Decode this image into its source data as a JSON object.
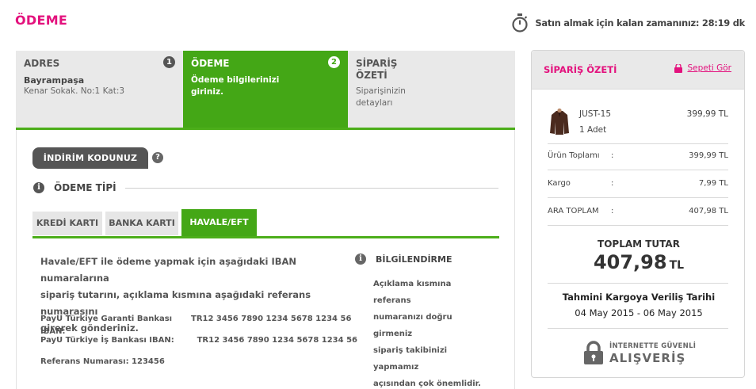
{
  "page": {
    "title": "ÖDEME",
    "timer_text": "Satın almak için kalan zamanınız: 28:19 dk"
  },
  "steps": [
    {
      "title": "ADRES",
      "number": "1",
      "sub": "Bayrampaşa",
      "desc": "Kenar Sokak. No:1 Kat:3",
      "active": false
    },
    {
      "title": "ÖDEME",
      "number": "2",
      "desc_line1": "Ödeme bilgilerinizi",
      "desc_line2": "giriniz.",
      "active": true
    },
    {
      "title_line1": "SİPARİŞ",
      "title_line2": "ÖZETİ",
      "desc_line1": "Siparişinizin",
      "desc_line2": "detayları",
      "active": false
    }
  ],
  "discount": {
    "button_label": "İNDİRİM KODUNUZ",
    "help": "?"
  },
  "payment": {
    "info_glyph": "i",
    "section_title": "ÖDEME TİPİ",
    "tabs": [
      "KREDİ KARTI",
      "BANKA KARTI",
      "HAVALE/EFT"
    ],
    "active_tab": "HAVALE/EFT",
    "instructions_line1": "Havale/EFT ile ödeme yapmak için aşağıdaki IBAN numaralarına",
    "instructions_line2": "sipariş tutarını, açıklama kısmına aşağıdaki referans numarasını",
    "instructions_line3": "girerek gönderiniz.",
    "ibans": [
      {
        "label": "PayU Türkiye Garanti Bankası IBAN:",
        "value": "TR12 3456 7890 1234 5678 1234 56"
      },
      {
        "label": "PayU Türkiye İş Bankası IBAN:",
        "value": "TR12 3456 7890 1234 5678 1234 56"
      }
    ],
    "reference": "Referans Numarası: 123456",
    "info_title": "BİLGİLENDİRME",
    "info_line1": "Açıklama kısmına referans",
    "info_line2": "numaranızı doğru girmeniz",
    "info_line3": "sipariş takibinizi yapmamız",
    "info_line4": "açısından çok önemlidir."
  },
  "summary": {
    "title": "SİPARİŞ ÖZETİ",
    "basket_link": "Sepeti Gör",
    "product": {
      "name": "JUST-15",
      "qty": "1 Adet",
      "price": "399,99 TL"
    },
    "rows": [
      {
        "label": "Ürün Toplamı",
        "colon": ":",
        "value": "399,99 TL"
      },
      {
        "label": "Kargo",
        "colon": ":",
        "value": "7,99 TL"
      },
      {
        "label": "ARA TOPLAM",
        "colon": ":",
        "value": "407,98 TL"
      }
    ],
    "total_label": "TOPLAM TUTAR",
    "total_amount": "407,98",
    "total_currency": "TL",
    "ship_label": "Tahmini Kargoya Veriliş Tarihi",
    "ship_dates": "04 May 2015 - 06 May 2015",
    "secure_top": "İNTERNETTE GÜVENLİ",
    "secure_bottom": "ALIŞVERİŞ"
  },
  "colors": {
    "brand_pink": "#e3127d",
    "active_green": "#44a716"
  }
}
